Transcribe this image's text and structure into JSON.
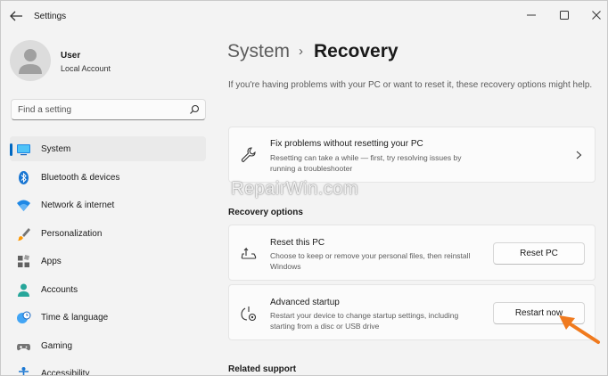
{
  "window": {
    "title": "Settings"
  },
  "user": {
    "name": "User",
    "account_type": "Local Account"
  },
  "search": {
    "placeholder": "Find a setting"
  },
  "nav": [
    {
      "label": "System",
      "icon": "monitor-icon",
      "active": true
    },
    {
      "label": "Bluetooth & devices",
      "icon": "bluetooth-icon"
    },
    {
      "label": "Network & internet",
      "icon": "wifi-icon"
    },
    {
      "label": "Personalization",
      "icon": "brush-icon"
    },
    {
      "label": "Apps",
      "icon": "apps-icon"
    },
    {
      "label": "Accounts",
      "icon": "person-icon"
    },
    {
      "label": "Time & language",
      "icon": "globe-clock-icon"
    },
    {
      "label": "Gaming",
      "icon": "gamepad-icon"
    },
    {
      "label": "Accessibility",
      "icon": "accessibility-icon"
    }
  ],
  "breadcrumb": {
    "parent": "System",
    "separator": "›",
    "current": "Recovery"
  },
  "intro": "If you're having problems with your PC or want to reset it, these recovery options might help.",
  "fix_card": {
    "title": "Fix problems without resetting your PC",
    "description": "Resetting can take a while — first, try resolving issues by running a troubleshooter"
  },
  "recovery_options": {
    "heading": "Recovery options",
    "reset": {
      "title": "Reset this PC",
      "description": "Choose to keep or remove your personal files, then reinstall Windows",
      "button": "Reset PC"
    },
    "advanced": {
      "title": "Advanced startup",
      "description": "Restart your device to change startup settings, including starting from a disc or USB drive",
      "button": "Restart now"
    }
  },
  "related_support": {
    "heading": "Related support"
  },
  "watermark": "RepairWin.com",
  "colors": {
    "accent": "#0067c0",
    "annotation_arrow": "#f07a1e"
  }
}
